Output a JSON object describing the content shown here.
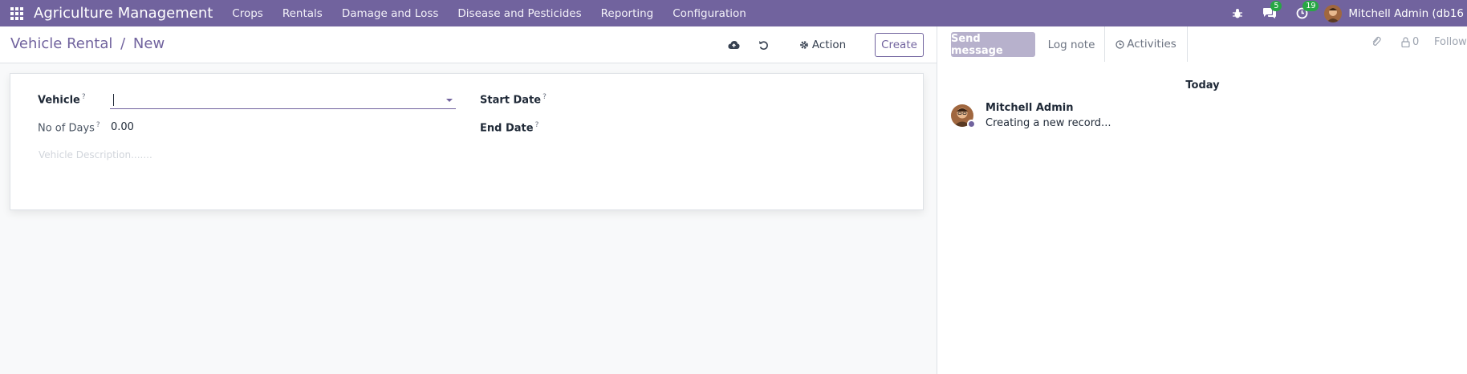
{
  "navbar": {
    "brand": "Agriculture Management",
    "menu": [
      "Crops",
      "Rentals",
      "Damage and Loss",
      "Disease and Pesticides",
      "Reporting",
      "Configuration"
    ],
    "messages_count": "5",
    "activities_count": "19",
    "user": "Mitchell Admin (db16"
  },
  "breadcrumb": {
    "parent": "Vehicle Rental",
    "separator": "/",
    "current": "New"
  },
  "toolbar": {
    "action_label": "Action",
    "create_label": "Create"
  },
  "form": {
    "vehicle_label": "Vehicle",
    "vehicle_value": "",
    "days_label": "No of Days",
    "days_value": "0.00",
    "start_date_label": "Start Date",
    "end_date_label": "End Date",
    "description_placeholder": "Vehicle Description.......",
    "help_mark": "?"
  },
  "chatter": {
    "send_message": "Send message",
    "log_note": "Log note",
    "activities": "Activities",
    "followers_count": "0",
    "follow_label": "Follow",
    "date_header": "Today",
    "author": "Mitchell Admin",
    "message": "Creating a new record..."
  },
  "colors": {
    "brand": "#71639e",
    "badge": "#28a745",
    "send_button": "#b7b1cc"
  }
}
